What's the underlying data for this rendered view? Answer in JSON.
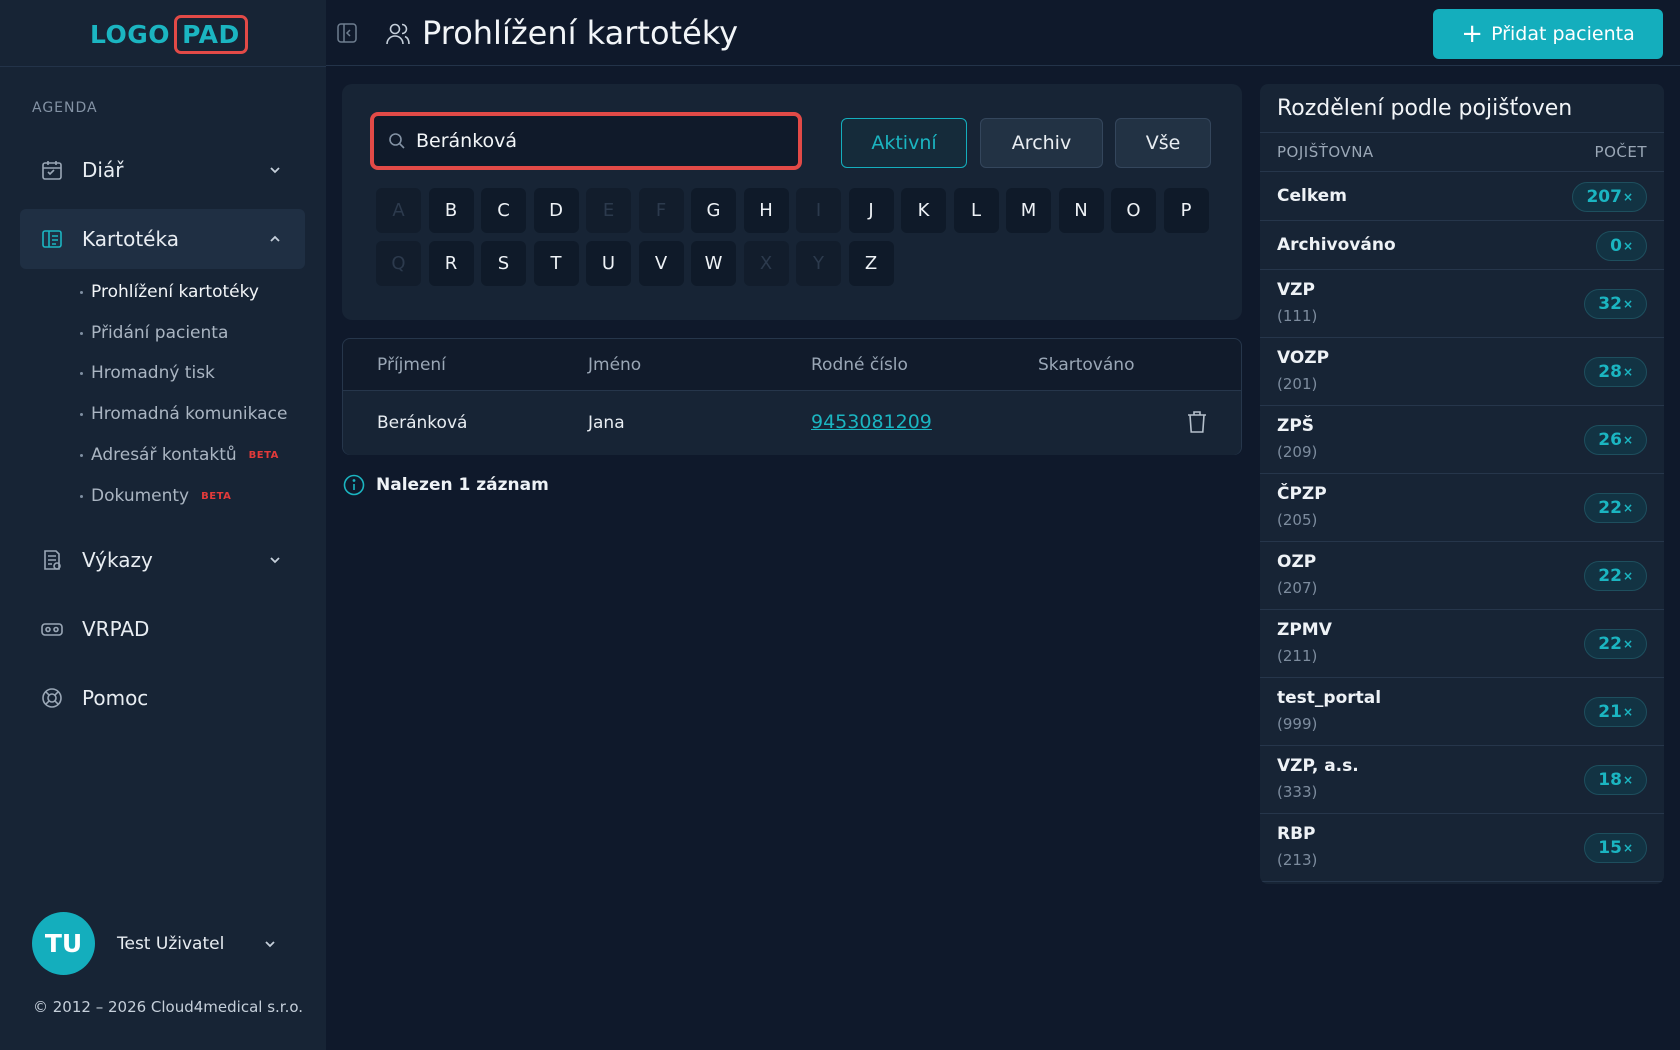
{
  "brand": {
    "logo_part1": "LOGO",
    "logo_part2": "PAD",
    "accent": "#14aebd",
    "highlight": "#e24a47"
  },
  "sidebar": {
    "section_label": "AGENDA",
    "items": [
      {
        "label": "Diář",
        "icon": "calendar-icon"
      },
      {
        "label": "Kartotéka",
        "icon": "card-file-icon"
      },
      {
        "label": "Výkazy",
        "icon": "report-icon"
      },
      {
        "label": "VRPAD",
        "icon": "vr-headset-icon"
      },
      {
        "label": "Pomoc",
        "icon": "lifebuoy-icon"
      }
    ],
    "subitems": [
      {
        "label": "Prohlížení kartotéky",
        "beta": ""
      },
      {
        "label": "Přidání pacienta",
        "beta": ""
      },
      {
        "label": "Hromadný tisk",
        "beta": ""
      },
      {
        "label": "Hromadná komunikace",
        "beta": ""
      },
      {
        "label": "Adresář kontaktů",
        "beta": "BETA"
      },
      {
        "label": "Dokumenty",
        "beta": "BETA"
      }
    ],
    "user": {
      "initials": "TU",
      "name": "Test Uživatel"
    },
    "copyright": "© 2012 – 2026 Cloud4medical s.r.o."
  },
  "header": {
    "title": "Prohlížení kartotéky",
    "add_button": "Přidat pacienta"
  },
  "search": {
    "value": "Beránková",
    "filters": [
      "Aktivní",
      "Archiv",
      "Vše"
    ],
    "letters_row1": [
      {
        "l": "A",
        "d": true
      },
      {
        "l": "B",
        "d": false
      },
      {
        "l": "C",
        "d": false
      },
      {
        "l": "D",
        "d": false
      },
      {
        "l": "E",
        "d": true
      },
      {
        "l": "F",
        "d": true
      },
      {
        "l": "G",
        "d": false
      },
      {
        "l": "H",
        "d": false
      },
      {
        "l": "I",
        "d": true
      },
      {
        "l": "J",
        "d": false
      },
      {
        "l": "K",
        "d": false
      },
      {
        "l": "L",
        "d": false
      },
      {
        "l": "M",
        "d": false
      },
      {
        "l": "N",
        "d": false
      },
      {
        "l": "O",
        "d": false
      },
      {
        "l": "P",
        "d": false
      }
    ],
    "letters_row2": [
      {
        "l": "Q",
        "d": true
      },
      {
        "l": "R",
        "d": false
      },
      {
        "l": "S",
        "d": false
      },
      {
        "l": "T",
        "d": false
      },
      {
        "l": "U",
        "d": false
      },
      {
        "l": "V",
        "d": false
      },
      {
        "l": "W",
        "d": false
      },
      {
        "l": "X",
        "d": true
      },
      {
        "l": "Y",
        "d": true
      },
      {
        "l": "Z",
        "d": false
      }
    ]
  },
  "table": {
    "columns": [
      "Příjmení",
      "Jméno",
      "Rodné číslo",
      "Skartováno"
    ],
    "rows": [
      {
        "surname": "Beránková",
        "name": "Jana",
        "birth_number": "9453081209",
        "shredded": ""
      }
    ],
    "result_text": "Nalezen 1 záznam"
  },
  "insurance": {
    "title": "Rozdělení podle pojišťoven",
    "col_insurer": "POJIŠŤOVNA",
    "col_count": "POČET",
    "rows": [
      {
        "name": "Celkem",
        "code": "",
        "count": "207"
      },
      {
        "name": "Archivováno",
        "code": "",
        "count": "0"
      },
      {
        "name": "VZP",
        "code": "(111)",
        "count": "32"
      },
      {
        "name": "VOZP",
        "code": "(201)",
        "count": "28"
      },
      {
        "name": "ZPŠ",
        "code": "(209)",
        "count": "26"
      },
      {
        "name": "ČPZP",
        "code": "(205)",
        "count": "22"
      },
      {
        "name": "OZP",
        "code": "(207)",
        "count": "22"
      },
      {
        "name": "ZPMV",
        "code": "(211)",
        "count": "22"
      },
      {
        "name": "test_portal",
        "code": "(999)",
        "count": "21"
      },
      {
        "name": "VZP, a.s.",
        "code": "(333)",
        "count": "18"
      },
      {
        "name": "RBP",
        "code": "(213)",
        "count": "15"
      }
    ]
  }
}
